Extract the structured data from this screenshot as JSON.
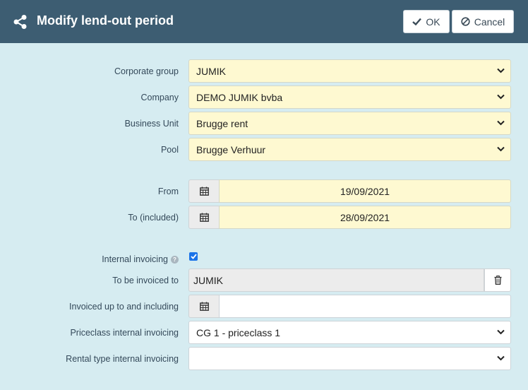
{
  "header": {
    "title": "Modify lend-out period",
    "ok_label": "OK",
    "cancel_label": "Cancel"
  },
  "form": {
    "corporate_group": {
      "label": "Corporate group",
      "value": "JUMIK"
    },
    "company": {
      "label": "Company",
      "value": "DEMO JUMIK bvba"
    },
    "business_unit": {
      "label": "Business Unit",
      "value": "Brugge rent"
    },
    "pool": {
      "label": "Pool",
      "value": "Brugge Verhuur"
    },
    "from": {
      "label": "From",
      "value": "19/09/2021"
    },
    "to": {
      "label": "To (included)",
      "value": "28/09/2021"
    },
    "internal_invoicing": {
      "label": "Internal invoicing",
      "checked": true,
      "help": "?"
    },
    "to_be_invoiced_to": {
      "label": "To be invoiced to",
      "value": "JUMIK"
    },
    "invoiced_up_to": {
      "label": "Invoiced up to and including",
      "value": ""
    },
    "priceclass": {
      "label": "Priceclass internal invoicing",
      "value": "CG 1 - priceclass 1"
    },
    "rental_type": {
      "label": "Rental type internal invoicing",
      "value": ""
    }
  },
  "colors": {
    "header_bg": "#3d5d72",
    "page_bg": "#d6ecf1",
    "required_field_bg": "#fef9d1",
    "checkbox": "#1a73e8"
  }
}
